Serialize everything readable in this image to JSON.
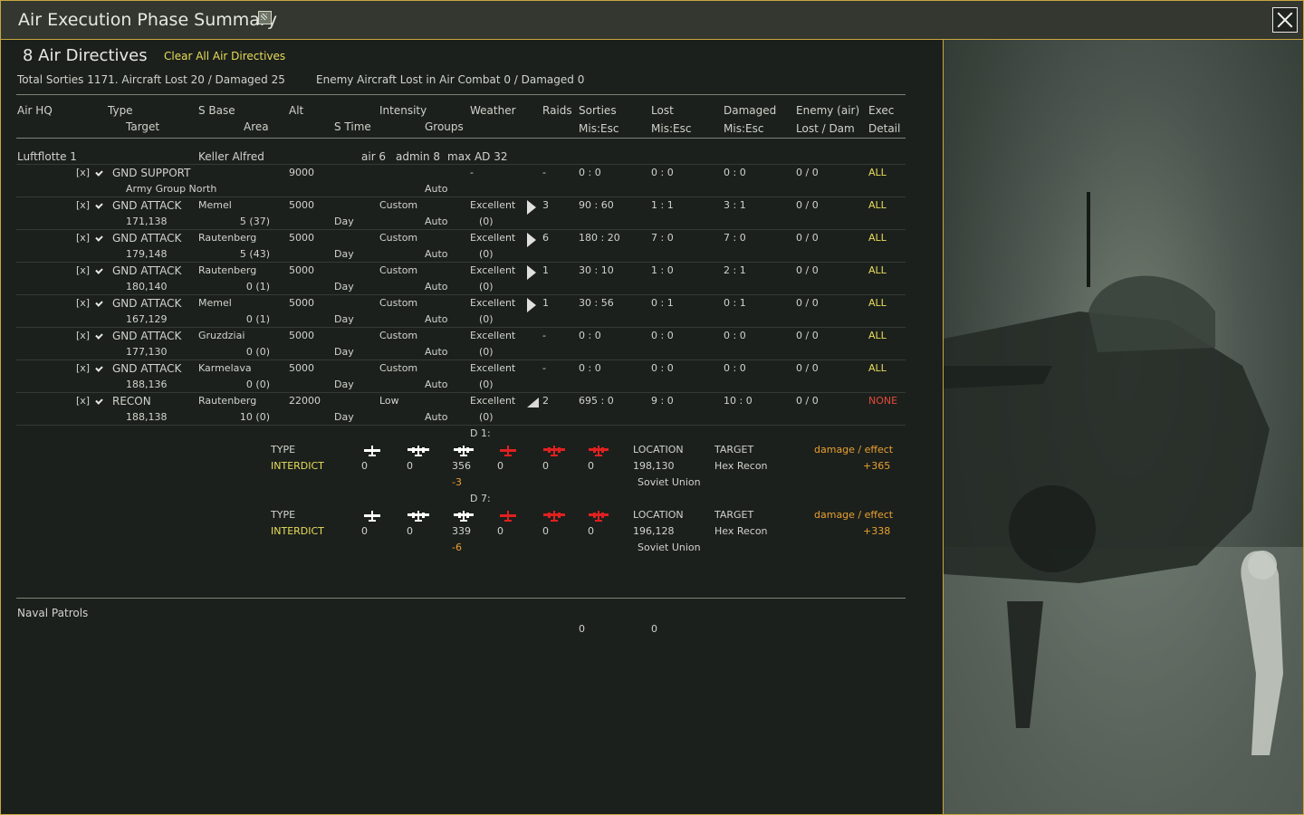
{
  "window": {
    "title": "Air Execution Phase Summary"
  },
  "summary": {
    "directives_count": "8 Air Directives",
    "clear_all": "Clear All Air Directives",
    "totals": "Total Sorties 1171. Aircraft Lost 20 / Damaged 25",
    "enemy": "Enemy Aircraft Lost in Air Combat 0 / Damaged 0"
  },
  "headers": {
    "air_hq": "Air HQ",
    "type": "Type",
    "target": "Target",
    "s_base": "S Base",
    "area": "Area",
    "alt": "Alt",
    "s_time": "S Time",
    "intensity": "Intensity",
    "groups": "Groups",
    "weather": "Weather",
    "raids": "Raids",
    "sorties": "Sorties",
    "sorties_sub": "Mis:Esc",
    "lost": "Lost",
    "lost_sub": "Mis:Esc",
    "damaged": "Damaged",
    "damaged_sub": "Mis:Esc",
    "enemy_air": "Enemy (air)",
    "enemy_sub": "Lost / Dam",
    "exec": "Exec",
    "exec_sub": "Detail"
  },
  "hq": {
    "name": "Luftflotte 1",
    "commander": "Keller Alfred",
    "air": "air 6",
    "admin": "admin 8",
    "max_ad": "max AD 32"
  },
  "directives": [
    {
      "mark": "[x]",
      "type": "GND SUPPORT",
      "target": "Army Group North",
      "base": "",
      "area": "",
      "alt": "9000",
      "stime": "",
      "intensity": "",
      "groups": "Auto",
      "weather": "-",
      "weather_sub": "",
      "raid_icon": "none",
      "raids": "-",
      "sorties": "0 : 0",
      "lost": "0 : 0",
      "damaged": "0 : 0",
      "enemy": "0 / 0",
      "exec": "ALL"
    },
    {
      "mark": "[x]",
      "type": "GND ATTACK",
      "target": "171,138",
      "base": "Memel",
      "area": "5 (37)",
      "alt": "5000",
      "stime": "Day",
      "intensity": "Custom",
      "groups": "Auto",
      "weather": "Excellent",
      "weather_sub": "(0)",
      "raid_icon": "arrow",
      "raids": "3",
      "sorties": "90 : 60",
      "lost": "1 : 1",
      "damaged": "3 : 1",
      "enemy": "0 / 0",
      "exec": "ALL"
    },
    {
      "mark": "[x]",
      "type": "GND ATTACK",
      "target": "179,148",
      "base": "Rautenberg",
      "area": "5 (43)",
      "alt": "5000",
      "stime": "Day",
      "intensity": "Custom",
      "groups": "Auto",
      "weather": "Excellent",
      "weather_sub": "(0)",
      "raid_icon": "arrow",
      "raids": "6",
      "sorties": "180 : 20",
      "lost": "7 : 0",
      "damaged": "7 : 0",
      "enemy": "0 / 0",
      "exec": "ALL"
    },
    {
      "mark": "[x]",
      "type": "GND ATTACK",
      "target": "180,140",
      "base": "Rautenberg",
      "area": "0 (1)",
      "alt": "5000",
      "stime": "Day",
      "intensity": "Custom",
      "groups": "Auto",
      "weather": "Excellent",
      "weather_sub": "(0)",
      "raid_icon": "arrow",
      "raids": "1",
      "sorties": "30 : 10",
      "lost": "1 : 0",
      "damaged": "2 : 1",
      "enemy": "0 / 0",
      "exec": "ALL"
    },
    {
      "mark": "[x]",
      "type": "GND ATTACK",
      "target": "167,129",
      "base": "Memel",
      "area": "0 (1)",
      "alt": "5000",
      "stime": "Day",
      "intensity": "Custom",
      "groups": "Auto",
      "weather": "Excellent",
      "weather_sub": "(0)",
      "raid_icon": "arrow",
      "raids": "1",
      "sorties": "30 : 56",
      "lost": "0 : 1",
      "damaged": "0 : 1",
      "enemy": "0 / 0",
      "exec": "ALL"
    },
    {
      "mark": "[x]",
      "type": "GND ATTACK",
      "target": "177,130",
      "base": "Gruzdziai",
      "area": "0 (0)",
      "alt": "5000",
      "stime": "Day",
      "intensity": "Custom",
      "groups": "Auto",
      "weather": "Excellent",
      "weather_sub": "(0)",
      "raid_icon": "none",
      "raids": "-",
      "sorties": "0 : 0",
      "lost": "0 : 0",
      "damaged": "0 : 0",
      "enemy": "0 / 0",
      "exec": "ALL"
    },
    {
      "mark": "[x]",
      "type": "GND ATTACK",
      "target": "188,136",
      "base": "Karmelava",
      "area": "0 (0)",
      "alt": "5000",
      "stime": "Day",
      "intensity": "Custom",
      "groups": "Auto",
      "weather": "Excellent",
      "weather_sub": "(0)",
      "raid_icon": "none",
      "raids": "-",
      "sorties": "0 : 0",
      "lost": "0 : 0",
      "damaged": "0 : 0",
      "enemy": "0 / 0",
      "exec": "ALL"
    },
    {
      "mark": "[x]",
      "type": "RECON",
      "target": "188,138",
      "base": "Rautenberg",
      "area": "10 (0)",
      "alt": "22000",
      "stime": "Day",
      "intensity": "Low",
      "groups": "Auto",
      "weather": "Excellent",
      "weather_sub": "(0)",
      "raid_icon": "triangle",
      "raids": "2",
      "sorties": "695 : 0",
      "lost": "9 : 0",
      "damaged": "10 : 0",
      "enemy": "0 / 0",
      "exec": "NONE"
    }
  ],
  "details": [
    {
      "day": "D 1:",
      "type_label": "TYPE",
      "type": "INTERDICT",
      "counts": [
        "0",
        "0",
        "356",
        "0",
        "0",
        "0"
      ],
      "delta": "-3",
      "location_label": "LOCATION",
      "location": "198,130",
      "country": "Soviet Union",
      "target_label": "TARGET",
      "target": "Hex Recon",
      "effect_label": "damage / effect",
      "effect": "+365"
    },
    {
      "day": "D 7:",
      "type_label": "TYPE",
      "type": "INTERDICT",
      "counts": [
        "0",
        "0",
        "339",
        "0",
        "0",
        "0"
      ],
      "delta": "-6",
      "location_label": "LOCATION",
      "location": "196,128",
      "country": "Soviet Union",
      "target_label": "TARGET",
      "target": "Hex Recon",
      "effect_label": "damage / effect",
      "effect": "+338"
    }
  ],
  "naval": {
    "title": "Naval Patrols",
    "sorties": "0",
    "lost": "0"
  },
  "colors": {
    "accent_border": "#c8a640",
    "exec_all": "#e8dc5a",
    "exec_none": "#e24a3a",
    "effect": "#e8a030",
    "enemy_plane": "#e02020",
    "friendly_plane": "#ffffff"
  }
}
